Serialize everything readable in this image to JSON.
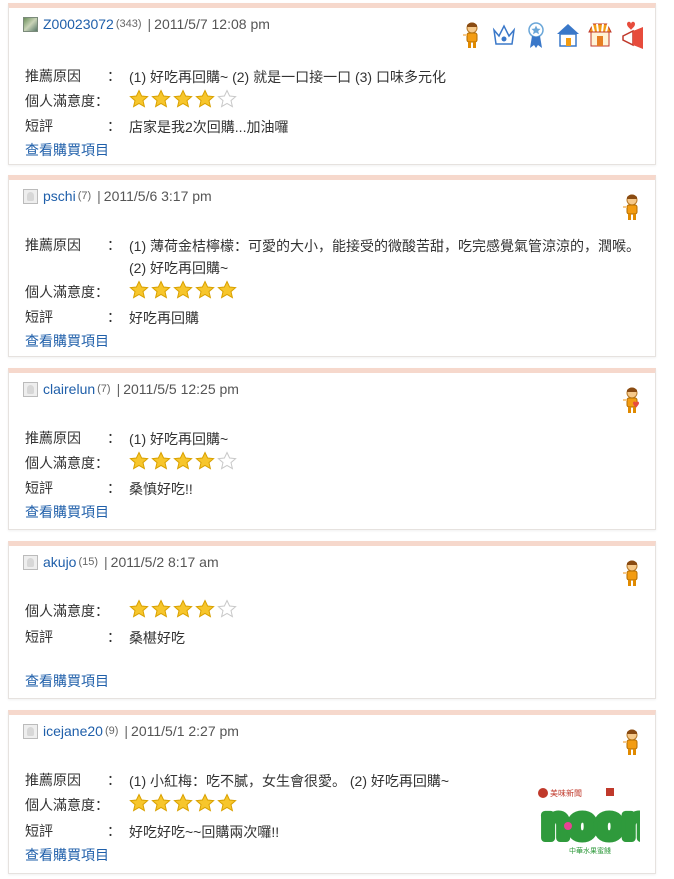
{
  "labels": {
    "reason": "推薦原因",
    "satisfaction": "個人滿意度：",
    "comment": "短評",
    "colon": "：",
    "view_items": "查看購買項目"
  },
  "reviews": [
    {
      "user": "Z00023072",
      "count": "(343)",
      "time": "2011/5/7  12:08 pm",
      "reason": "(1) 好吃再回購~   (2) 就是一口接一口   (3) 口味多元化",
      "rating": 4,
      "comment": "店家是我2次回購...加油囉"
    },
    {
      "user": "pschi",
      "count": "(7)",
      "time": "2011/5/6  3:17 pm",
      "reason": "(1) 薄荷金桔檸檬：可愛的大小，能接受的微酸苦甜，吃完感覺氣管涼涼的，潤喉。   (2) 好吃再回購~",
      "rating": 5,
      "comment": "好吃再回購"
    },
    {
      "user": "clairelun",
      "count": "(7)",
      "time": "2011/5/5  12:25 pm",
      "reason": "(1) 好吃再回購~",
      "rating": 4,
      "comment": "桑慎好吃!!"
    },
    {
      "user": "akujo",
      "count": "(15)",
      "time": "2011/5/2  8:17 am",
      "rating": 4,
      "comment": "桑椹好吃"
    },
    {
      "user": "icejane20",
      "count": "(9)",
      "time": "2011/5/1  2:27 pm",
      "reason": "(1) 小紅梅：吃不膩，女生會很愛。   (2) 好吃再回購~",
      "rating": 5,
      "comment": "好吃好吃~~回購兩次囉!!"
    }
  ],
  "logo": {
    "brand": "noon",
    "caption": "中華水果蜜餞",
    "stamp": "美味新聞"
  },
  "badge_icons": [
    "member-icon",
    "crown-icon",
    "medal-icon",
    "house-icon",
    "shop-icon",
    "love-megaphone-icon"
  ],
  "colors": {
    "link": "#1f5faa",
    "card_top": "#f6d8cc",
    "star": "#f5c518",
    "logo_green": "#2f9a3c"
  }
}
